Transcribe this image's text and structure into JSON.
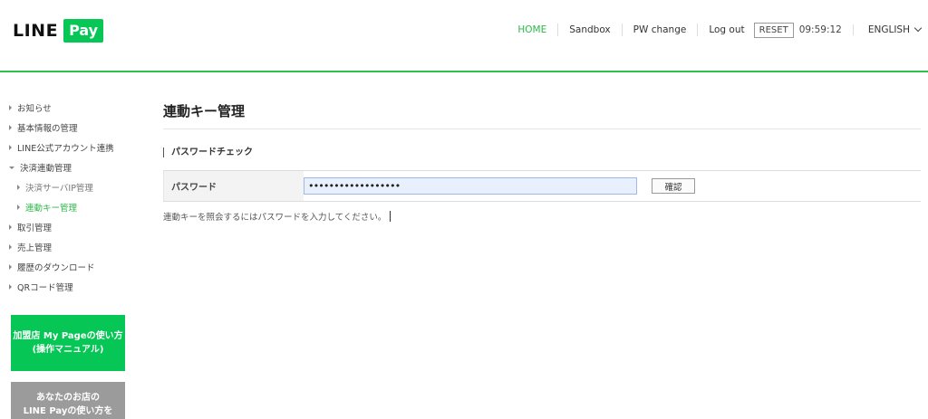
{
  "header": {
    "logo_line": "LINE",
    "logo_pay": "Pay",
    "nav": {
      "home": "HOME",
      "sandbox": "Sandbox",
      "pw_change": "PW change",
      "logout": "Log out",
      "reset": "RESET",
      "time": "09:59:12",
      "language": "ENGLISH"
    }
  },
  "sidebar": {
    "items": [
      {
        "label": "お知らせ"
      },
      {
        "label": "基本情報の管理"
      },
      {
        "label": "LINE公式アカウント連携"
      },
      {
        "label": "決済連動管理"
      },
      {
        "label": "決済サーバIP管理"
      },
      {
        "label": "連動キー管理"
      },
      {
        "label": "取引管理"
      },
      {
        "label": "売上管理"
      },
      {
        "label": "履歴のダウンロード"
      },
      {
        "label": "QRコード管理"
      }
    ],
    "banner_manual": {
      "line1": "加盟店 My Pageの使い方",
      "line2": "(操作マニュアル)"
    },
    "banner_guide": {
      "line1": "あなたのお店の",
      "line2": "LINE Payの使い方を"
    }
  },
  "main": {
    "title": "連動キー管理",
    "section_title": "パスワードチェック",
    "form": {
      "password_label": "パスワード",
      "password_value": "••••••••••••••••••",
      "confirm_button": "確認"
    },
    "help_text": "連動キーを照会するにはパスワードを入力してください。"
  },
  "colors": {
    "brand_green": "#06c755",
    "accent_green": "#2db84a"
  }
}
